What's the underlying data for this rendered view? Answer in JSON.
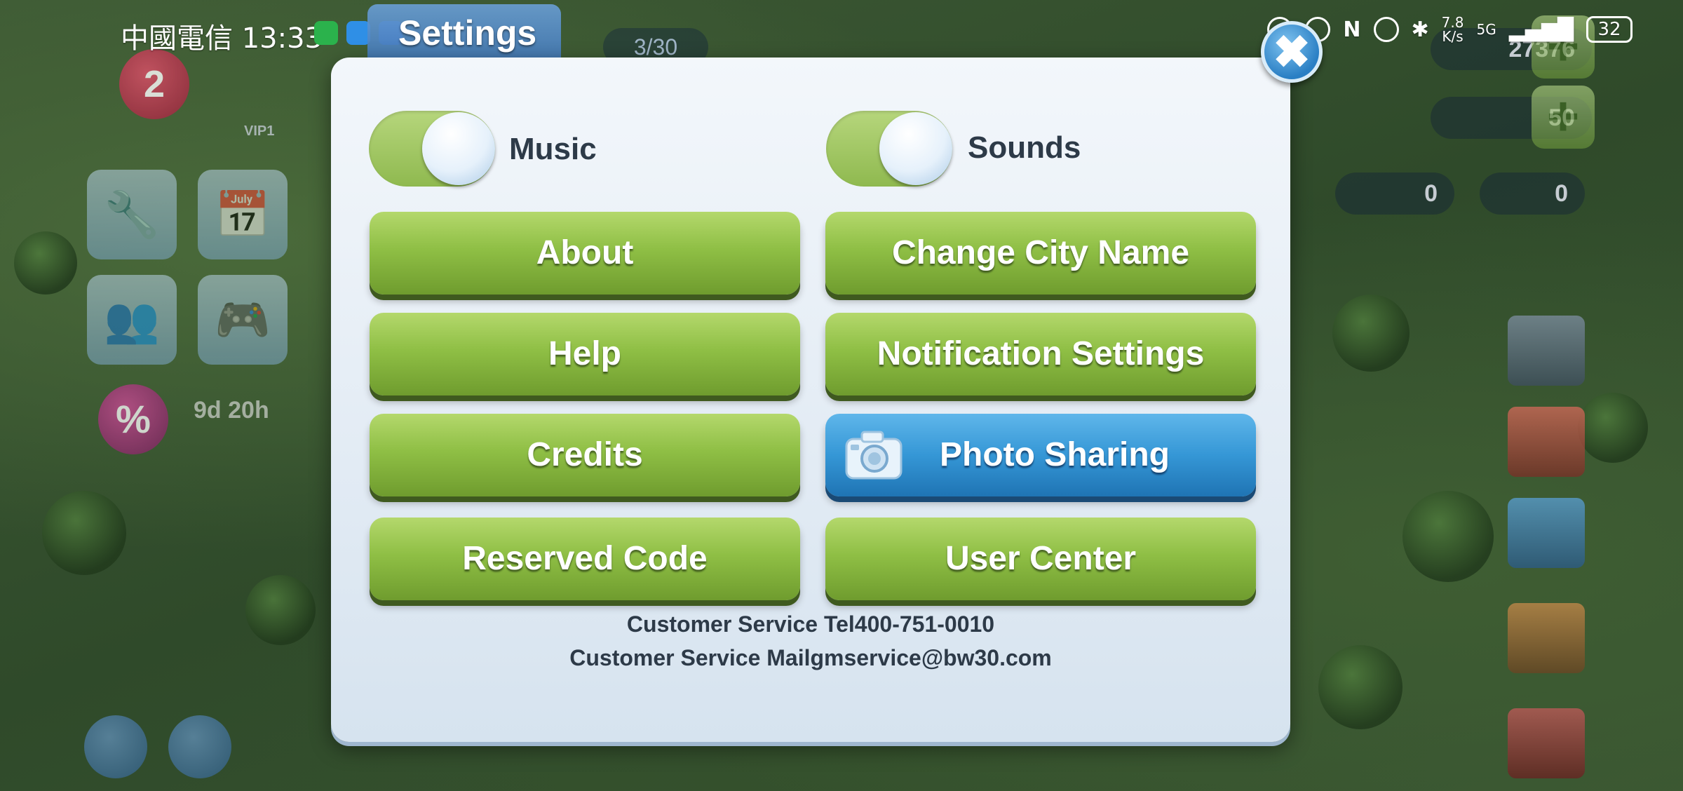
{
  "status_bar": {
    "carrier": "中國電信",
    "time": "13:33",
    "net_speed_value": "7.8",
    "net_speed_unit": "K/s",
    "network": "5G",
    "battery": "32"
  },
  "hud": {
    "level": "2",
    "vip": "VIP1",
    "sale_icon": "%",
    "sale_timer": "9d 20h",
    "progress": "3/30",
    "currency_partial": "27376",
    "cash": "50",
    "key_silver": "0",
    "key_gold": "0"
  },
  "dialog": {
    "title": "Settings",
    "music": {
      "label": "Music",
      "on": true
    },
    "sounds": {
      "label": "Sounds",
      "on": true
    },
    "buttons": {
      "about": "About",
      "change_city_name": "Change City Name",
      "help": "Help",
      "notification_settings": "Notification Settings",
      "credits": "Credits",
      "photo_sharing": "Photo Sharing",
      "reserved_code": "Reserved Code",
      "user_center": "User Center"
    },
    "customer_service_tel": "Customer Service Tel400-751-0010",
    "customer_service_mail": "Customer Service Mailgmservice@bw30.com"
  },
  "colors": {
    "green_button": "#8fbf45",
    "blue_button": "#3597d6",
    "toggle_on": "#9dc35c",
    "dialog_bg": "#e6eef6",
    "text_dark": "#2d3a48"
  }
}
